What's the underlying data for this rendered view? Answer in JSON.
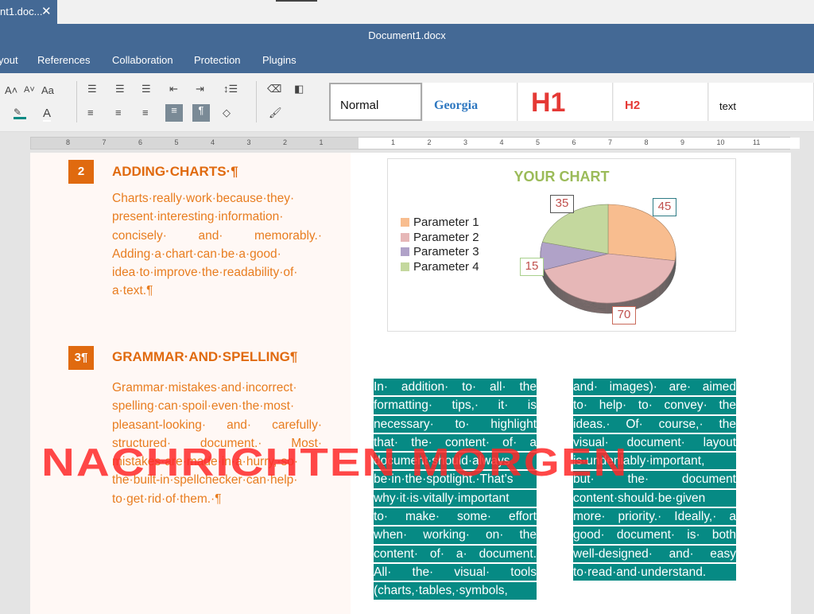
{
  "tab": {
    "title": "nt1.doc...",
    "close": "✕"
  },
  "window": {
    "title": "Document1.docx"
  },
  "menu": [
    "yout",
    "References",
    "Collaboration",
    "Protection",
    "Plugins"
  ],
  "toolbar": {
    "increase_font": "A˄",
    "decrease_font": "A˅",
    "change_case": "Aa",
    "pilcrow": "¶",
    "styles": [
      "Normal",
      "Georgia",
      "H1",
      "H2",
      "text"
    ]
  },
  "ruler": {
    "left_ticks": [
      "8",
      "7",
      "6",
      "5",
      "4",
      "3",
      "2",
      "1"
    ],
    "right_ticks": [
      "1",
      "2",
      "3",
      "4",
      "5",
      "6",
      "7",
      "8",
      "9",
      "10",
      "11"
    ]
  },
  "sections": [
    {
      "number": "2",
      "heading": "ADDING·CHARTS·¶",
      "lines": [
        "Charts·really·work·because·they·",
        "present·interesting·information·",
        "concisely·   and·   memorably.·",
        "Adding·a·chart·can·be·a·good·",
        "idea·to·improve·the·readability·of·",
        "a·text.¶"
      ]
    },
    {
      "number": "3¶",
      "heading": "GRAMMAR·AND·SPELLING¶",
      "lines": [
        "Grammar·mistakes·and·incorrect·",
        "spelling·can·spoil·even·the·most·",
        "pleasant-looking·  and·  carefully·",
        "structured·   document.·   Most·",
        "mistakes·are·made·in·a·hurry,·so·",
        "the·built-in·spellchecker·can·help·",
        "to·get·rid·of·them.·¶"
      ]
    }
  ],
  "column1": [
    "In· addition· to· all· the",
    "formatting· tips,· it· is",
    "necessary· to· highlight",
    "that· the· content· of· a",
    "document·should·always",
    "be·in·the·spotlight.·That’s",
    "why·it·is·vitally·important",
    "to· make· some· effort",
    "when· working· on· the",
    "content· of· a· document.",
    "All· the· visual· tools",
    "(charts,·tables,·symbols,"
  ],
  "column2": [
    "and· images)· are· aimed",
    "to· help· to· convey· the",
    "ideas.· Of· course,· the",
    "visual· document· layout",
    "is·undeniably·important,",
    "but·   the·   document",
    "content·should·be·given",
    "more· priority.· Ideally,· a",
    "good· document· is· both",
    "well-designed· and· easy",
    "to·read·and·understand."
  ],
  "watermark": "NACHRICHTEN MORGEN",
  "chart_data": {
    "type": "pie",
    "title": "YOUR CHART",
    "legend": "left",
    "categories": [
      "Parameter 1",
      "Parameter 2",
      "Parameter 3",
      "Parameter 4"
    ],
    "values": [
      45,
      70,
      15,
      35
    ],
    "colors": [
      "#f8bd8f",
      "#e6b7b7",
      "#b0a2c8",
      "#c4d89e"
    ],
    "label_borders": [
      "#2e7b85",
      "#c96a5a",
      "#a8d08d",
      "#555555"
    ]
  }
}
